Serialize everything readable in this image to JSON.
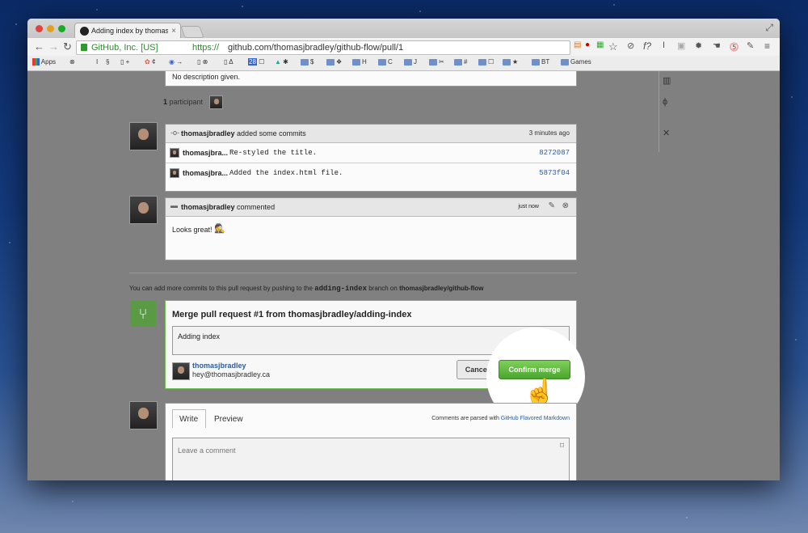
{
  "browser": {
    "tab_title": "Adding index by thomasjb",
    "tab_close": "×",
    "url_ev": "GitHub, Inc. [US]",
    "url_protocol": "https://",
    "url_rest": "github.com/thomasjbradley/github-flow/pull/1",
    "bookmarks": [
      "Apps",
      "⊗",
      "I",
      "§",
      "+",
      "¢",
      "→",
      "⊗",
      "Δ",
      "28",
      "☐",
      "✱",
      "$",
      "H",
      "C",
      "J",
      "✂",
      "#",
      "☐",
      "★",
      "BT",
      "Games"
    ]
  },
  "pr": {
    "no_description": "No description given.",
    "participants_count": "1",
    "participants_label": "participant",
    "commits_event_user": "thomasjbradley",
    "commits_event_text": "added some commits",
    "commits_event_time": "3 minutes ago",
    "commits": [
      {
        "author": "thomasjbra...",
        "message": "Re-styled the title.",
        "sha": "8272087"
      },
      {
        "author": "thomasjbra...",
        "message": "Added the index.html file.",
        "sha": "5873f04"
      }
    ],
    "comment_user": "thomasjbradley",
    "comment_action": "commented",
    "comment_time": "just now",
    "comment_body": "Looks great!",
    "push_info_prefix": "You can add more commits to this pull request by pushing to the",
    "push_info_branch": "adding-index",
    "push_info_middle": "branch on",
    "push_info_repo": "thomasjbradley/github-flow",
    "merge_title": "Merge pull request #1 from thomasjbradley/adding-index",
    "merge_message": "Adding index",
    "merge_user": "thomasjbradley",
    "merge_email": "hey@thomasjbradley.ca",
    "cancel_label": "Cancel",
    "confirm_label": "Confirm merge",
    "write_tab": "Write",
    "preview_tab": "Preview",
    "markdown_prefix": "Comments are parsed with",
    "markdown_link": "GitHub Flavored Markdown",
    "comment_placeholder": "Leave a comment"
  }
}
